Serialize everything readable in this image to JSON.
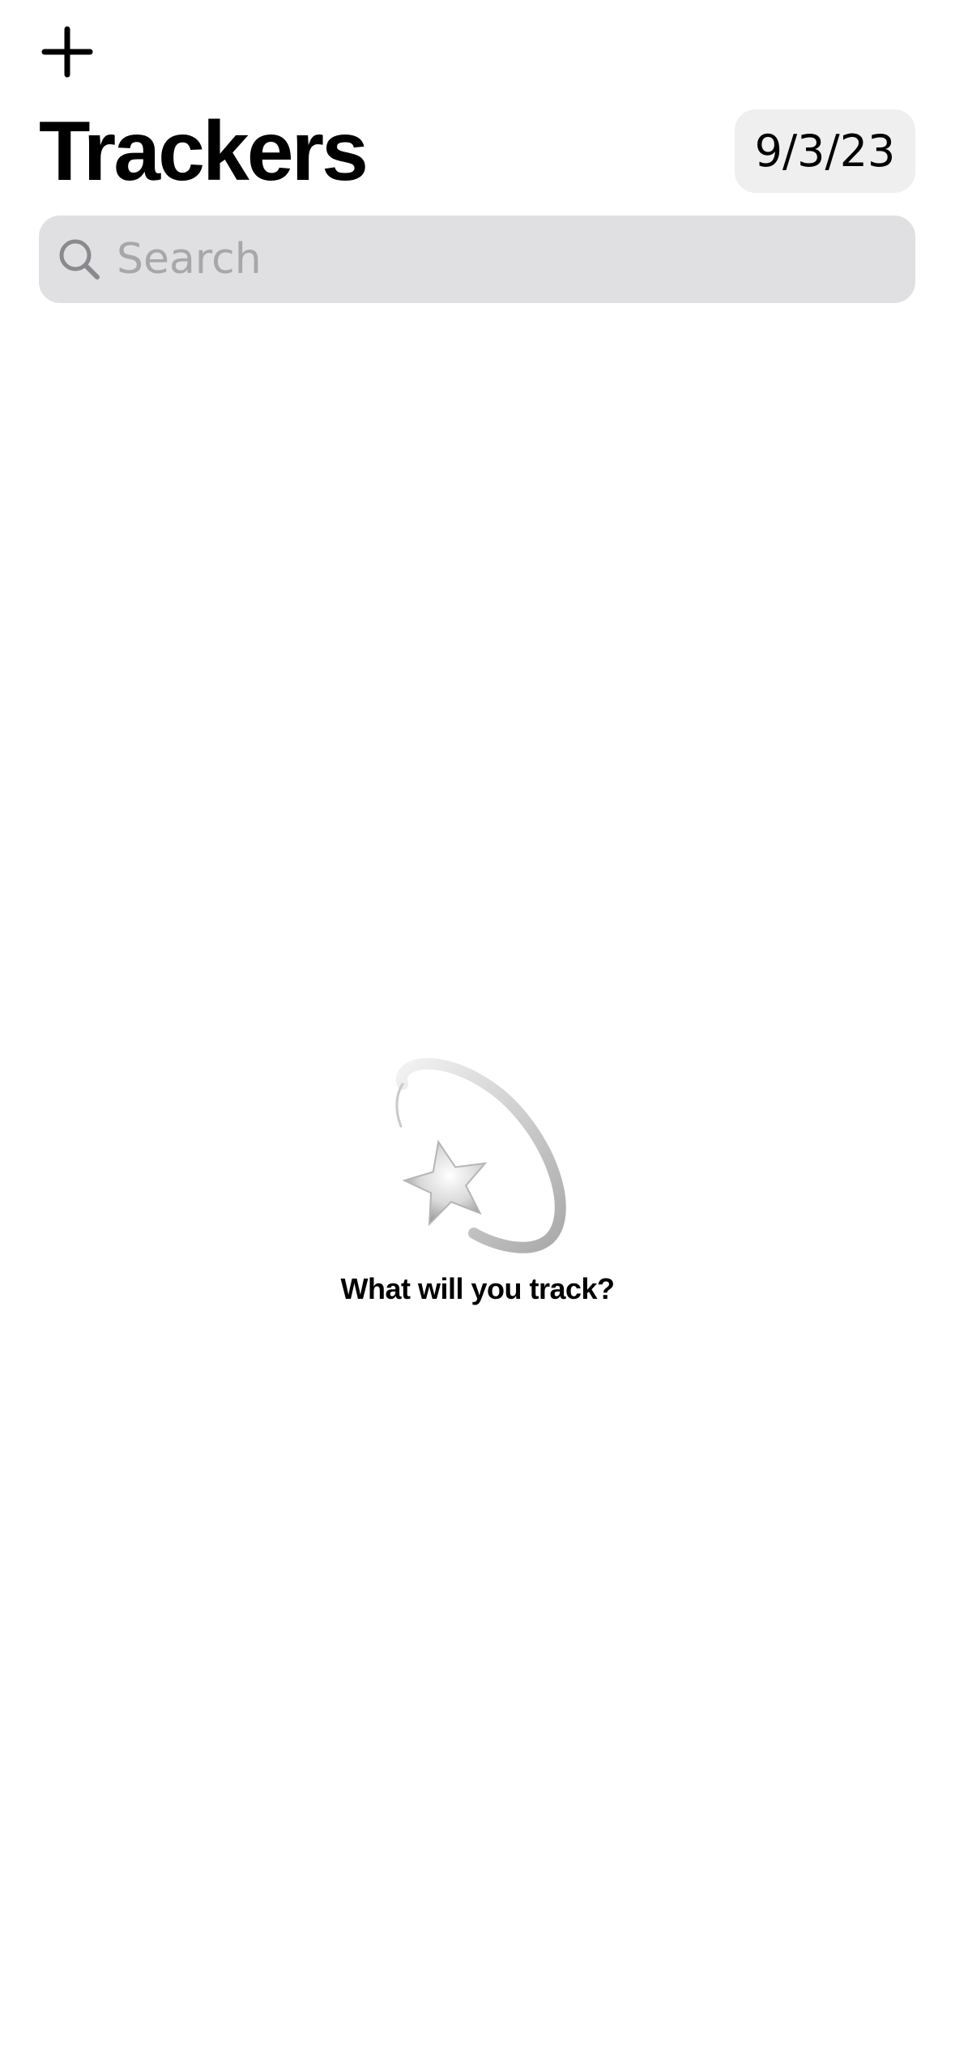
{
  "header": {
    "add_icon": "plus-icon",
    "title": "Trackers",
    "date": "9/3/23"
  },
  "search": {
    "icon": "search-icon",
    "placeholder": "Search",
    "value": ""
  },
  "empty_state": {
    "illustration": "shooting-star-icon",
    "message": "What will you track?"
  },
  "colors": {
    "background": "#ffffff",
    "text": "#000000",
    "search_background": "#e0e0e2",
    "date_background": "#efeff0",
    "placeholder": "#a7a7aa"
  }
}
